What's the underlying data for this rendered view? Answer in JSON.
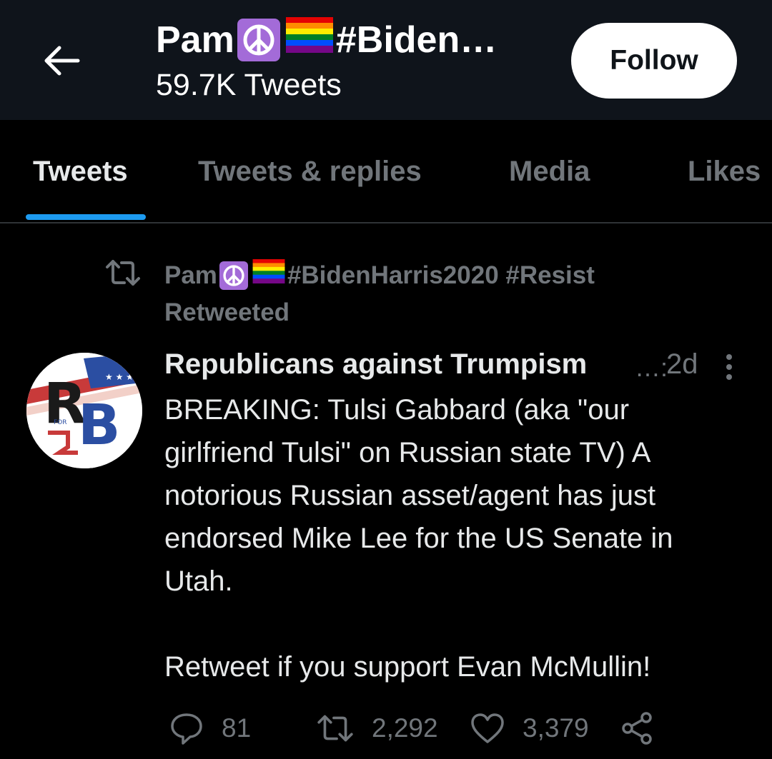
{
  "header": {
    "name_prefix": "Pam",
    "name_suffix": "#Biden…",
    "tweet_count": "59.7K Tweets",
    "follow_label": "Follow"
  },
  "tabs": [
    {
      "label": "Tweets",
      "active": true
    },
    {
      "label": "Tweets & replies",
      "active": false
    },
    {
      "label": "Media",
      "active": false
    },
    {
      "label": "Likes",
      "active": false
    }
  ],
  "retweet": {
    "name_prefix": "Pam",
    "name_suffix": "#BidenHarris2020 #Resist",
    "label": "Retweeted"
  },
  "tweet": {
    "avatar_text": "RB",
    "avatar_small_text": "FOR",
    "author": "Republicans against Trumpism",
    "author_mark": "…:",
    "time": "2d",
    "paragraphs": [
      "BREAKING: Tulsi Gabbard (aka \"our girlfriend Tulsi\" on Russian state TV) A notorious Russian asset/agent has just endorsed Mike Lee for the US Senate in Utah.",
      "Retweet if you support Evan McMullin!"
    ],
    "replies": "81",
    "retweets": "2,292",
    "likes": "3,379"
  },
  "icons": {
    "back": "arrow-left-icon",
    "peace": "peace-symbol-icon",
    "rainbow": "rainbow-flag-icon",
    "retweet": "retweet-icon",
    "more": "more-vertical-icon",
    "reply": "reply-icon",
    "like": "heart-icon",
    "share": "share-icon"
  },
  "colors": {
    "header_bg": "#0f141b",
    "background": "#000000",
    "accent": "#1d9bf0",
    "muted_text": "#71767b",
    "peace_purple": "#a36bd8"
  }
}
